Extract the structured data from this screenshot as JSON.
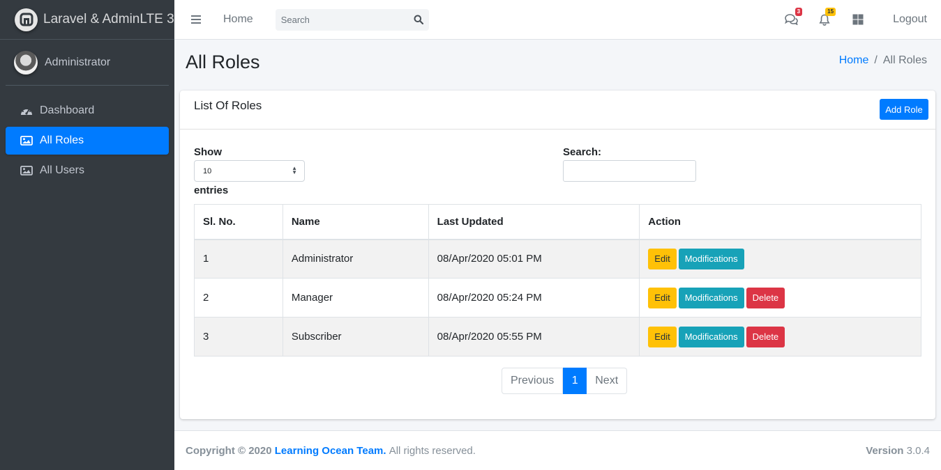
{
  "brand": {
    "title": "Laravel & AdminLTE 3"
  },
  "user": {
    "name": "Administrator"
  },
  "sidebar": {
    "items": [
      {
        "label": "Dashboard",
        "icon": "dashboard-icon"
      },
      {
        "label": "All Roles",
        "icon": "image-icon",
        "active": true
      },
      {
        "label": "All Users",
        "icon": "image-icon"
      }
    ]
  },
  "navbar": {
    "home": "Home",
    "search_placeholder": "Search",
    "messages_count": "3",
    "notifications_count": "15",
    "logout": "Logout"
  },
  "page": {
    "title": "All Roles",
    "breadcrumb": {
      "home": "Home",
      "separator": "/",
      "current": "All Roles"
    }
  },
  "card": {
    "title": "List Of Roles",
    "add_button": "Add Role",
    "show_label": "Show",
    "show_value": "10",
    "entries_label": "entries",
    "search_label": "Search:"
  },
  "table": {
    "headers": [
      "Sl. No.",
      "Name",
      "Last Updated",
      "Action"
    ],
    "rows": [
      {
        "sl": "1",
        "name": "Administrator",
        "updated": "08/Apr/2020 05:01 PM"
      },
      {
        "sl": "2",
        "name": "Manager",
        "updated": "08/Apr/2020 05:24 PM"
      },
      {
        "sl": "3",
        "name": "Subscriber",
        "updated": "08/Apr/2020 05:55 PM"
      }
    ],
    "edit_label": "Edit",
    "modifications_label": "Modifications",
    "delete_label": "Delete"
  },
  "pagination": {
    "previous": "Previous",
    "current": "1",
    "next": "Next"
  },
  "footer": {
    "copyright": "Copyright © 2020",
    "team": "Learning Ocean Team.",
    "rights": "All rights reserved.",
    "version_label": "Version",
    "version": "3.0.4"
  },
  "colors": {
    "primary": "#007bff",
    "warning": "#ffc107",
    "info": "#17a2b8",
    "danger": "#dc3545",
    "sidebar": "#343a40"
  }
}
